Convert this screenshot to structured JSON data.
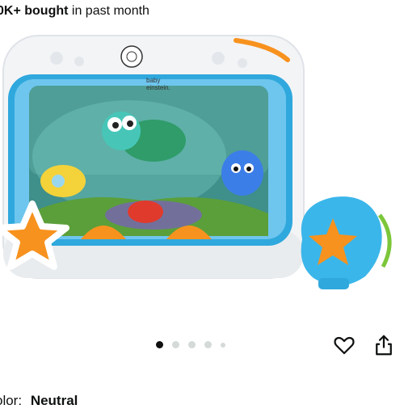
{
  "purchase_info": {
    "count": "0K+ bought",
    "suffix": "in past month"
  },
  "product": {
    "brand_logo": "baby einstein."
  },
  "gallery": {
    "dots_total": 5,
    "active_index": 0
  },
  "actions": {
    "favorite_icon": "heart-icon",
    "share_icon": "share-icon"
  },
  "variant": {
    "label": "olor:",
    "value": "Neutral"
  },
  "colors": {
    "accent_blue": "#2fa8dd",
    "accent_orange": "#f7921e",
    "dot_active": "#0f1111",
    "dot_inactive": "#d5d9d9"
  }
}
